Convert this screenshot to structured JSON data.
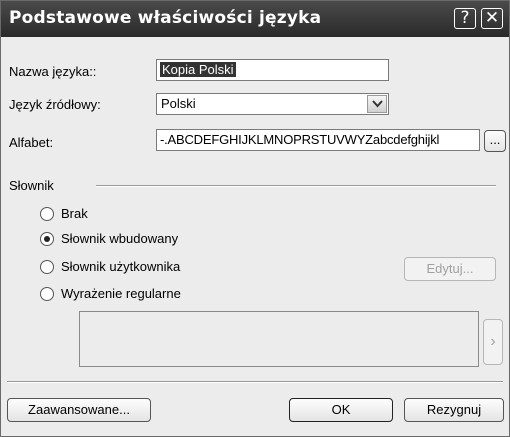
{
  "window": {
    "title": "Podstawowe właściwości języka",
    "help_label": "?",
    "close_label": "✕"
  },
  "form": {
    "name_label": "Nazwa języka::",
    "name_value": "Kopia Polski",
    "source_label": "Język źródłowy:",
    "source_value": "Polski",
    "alphabet_label": "Alfabet:",
    "alphabet_value": "-.ABCDEFGHIJKLMNOPRSTUVWYZabcdefghijkl",
    "alphabet_button": "..."
  },
  "dictionary": {
    "group_label": "Słownik",
    "options": [
      {
        "label": "Brak",
        "selected": false
      },
      {
        "label": "Słownik wbudowany",
        "selected": true
      },
      {
        "label": "Słownik użytkownika",
        "selected": false
      },
      {
        "label": "Wyrażenie regularne",
        "selected": false
      }
    ],
    "edit_button": "Edytuj...",
    "side_arrow": "›"
  },
  "footer": {
    "advanced_button": "Zaawansowane...",
    "ok_button": "OK",
    "cancel_button": "Rezygnuj"
  }
}
